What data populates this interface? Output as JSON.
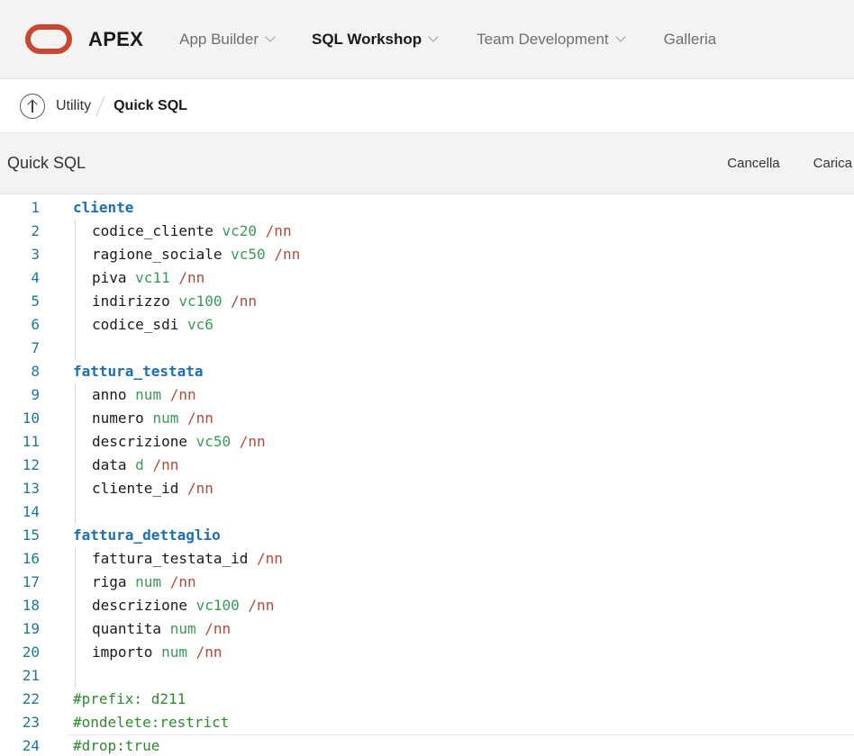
{
  "topbar": {
    "brand": "APEX",
    "nav": [
      {
        "label": "App Builder",
        "active": false,
        "has_menu": true
      },
      {
        "label": "SQL Workshop",
        "active": true,
        "has_menu": true
      },
      {
        "label": "Team Development",
        "active": false,
        "has_menu": true
      },
      {
        "label": "Galleria",
        "active": false,
        "has_menu": false
      }
    ]
  },
  "breadcrumb": {
    "parent": "Utility",
    "current": "Quick SQL"
  },
  "region": {
    "title": "Quick SQL",
    "actions": {
      "cancel": "Cancella",
      "load": "Carica"
    }
  },
  "colors": {
    "brand_red": "#c74634",
    "line_number": "#237893",
    "table_name": "#1c6fb5",
    "column_type": "#3b9a56",
    "option": "#b34a3a",
    "directive": "#2e8b2e"
  },
  "editor": {
    "lines": [
      {
        "n": "1",
        "kind": "table",
        "name": "cliente"
      },
      {
        "n": "2",
        "kind": "col",
        "name": "codice_cliente",
        "type": "vc20",
        "opt": "/nn"
      },
      {
        "n": "3",
        "kind": "col",
        "name": "ragione_sociale",
        "type": "vc50",
        "opt": "/nn"
      },
      {
        "n": "4",
        "kind": "col",
        "name": "piva",
        "type": "vc11",
        "opt": "/nn"
      },
      {
        "n": "5",
        "kind": "col",
        "name": "indirizzo",
        "type": "vc100",
        "opt": "/nn"
      },
      {
        "n": "6",
        "kind": "col",
        "name": "codice_sdi",
        "type": "vc6",
        "opt": ""
      },
      {
        "n": "7",
        "kind": "blank"
      },
      {
        "n": "8",
        "kind": "table",
        "name": "fattura_testata"
      },
      {
        "n": "9",
        "kind": "col",
        "name": "anno",
        "type": "num",
        "opt": "/nn"
      },
      {
        "n": "10",
        "kind": "col",
        "name": "numero",
        "type": "num",
        "opt": "/nn"
      },
      {
        "n": "11",
        "kind": "col",
        "name": "descrizione",
        "type": "vc50",
        "opt": "/nn"
      },
      {
        "n": "12",
        "kind": "col",
        "name": "data",
        "type": "d",
        "opt": "/nn"
      },
      {
        "n": "13",
        "kind": "col",
        "name": "cliente_id",
        "type": "",
        "opt": "/nn"
      },
      {
        "n": "14",
        "kind": "blank"
      },
      {
        "n": "15",
        "kind": "table",
        "name": "fattura_dettaglio"
      },
      {
        "n": "16",
        "kind": "col",
        "name": "fattura_testata_id",
        "type": "",
        "opt": "/nn"
      },
      {
        "n": "17",
        "kind": "col",
        "name": "riga",
        "type": "num",
        "opt": "/nn"
      },
      {
        "n": "18",
        "kind": "col",
        "name": "descrizione",
        "type": "vc100",
        "opt": "/nn"
      },
      {
        "n": "19",
        "kind": "col",
        "name": "quantita",
        "type": "num",
        "opt": "/nn"
      },
      {
        "n": "20",
        "kind": "col",
        "name": "importo",
        "type": "num",
        "opt": "/nn"
      },
      {
        "n": "21",
        "kind": "blank"
      },
      {
        "n": "22",
        "kind": "directive",
        "text": "#prefix: d211"
      },
      {
        "n": "23",
        "kind": "directive",
        "text": "#ondelete:restrict"
      },
      {
        "n": "24",
        "kind": "directive",
        "text": "#drop:true"
      }
    ]
  }
}
